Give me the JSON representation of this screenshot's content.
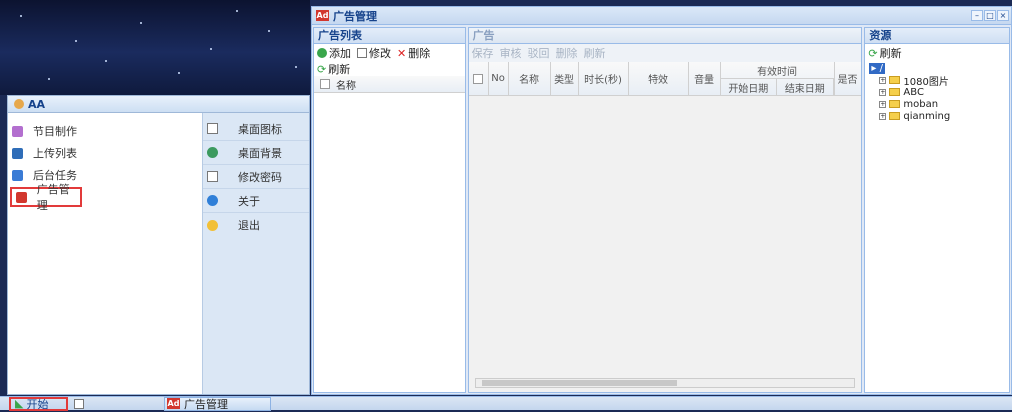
{
  "start_menu": {
    "user": "AA",
    "left_items": [
      {
        "label": "节目制作",
        "color": "#b36fcf"
      },
      {
        "label": "上传列表",
        "color": "#2f6db8"
      },
      {
        "label": "后台任务",
        "color": "#3a7bd5"
      },
      {
        "label": "广告管理",
        "color": "#d2372e"
      }
    ],
    "right_items": [
      {
        "label": "桌面图标"
      },
      {
        "label": "桌面背景"
      },
      {
        "label": "修改密码"
      },
      {
        "label": "关于"
      },
      {
        "label": "退出"
      }
    ]
  },
  "window": {
    "title": "广告管理",
    "icon_text": "Ad",
    "controls": [
      "–",
      "□",
      "×"
    ],
    "ad_list": {
      "header": "广告列表",
      "toolbar": {
        "add": "添加",
        "edit": "修改",
        "delete": "删除",
        "refresh": "刷新"
      },
      "column": "名称"
    },
    "ad_panel": {
      "header": "广告",
      "toolbar": [
        "保存",
        "审核",
        "驳回",
        "删除",
        "刷新"
      ],
      "columns": {
        "no": "No",
        "name": "名称",
        "type": "类型",
        "duration": "时长(秒)",
        "effect": "特效",
        "volume": "音量",
        "valid_group": "有效时间",
        "start_date": "开始日期",
        "end_date": "结束日期",
        "is": "是否"
      }
    },
    "resources": {
      "header": "资源",
      "refresh": "刷新",
      "root": "/",
      "folders": [
        "1080图片",
        "ABC",
        "moban",
        "qianming"
      ]
    }
  },
  "taskbar": {
    "start": "开始",
    "task": "广告管理"
  }
}
